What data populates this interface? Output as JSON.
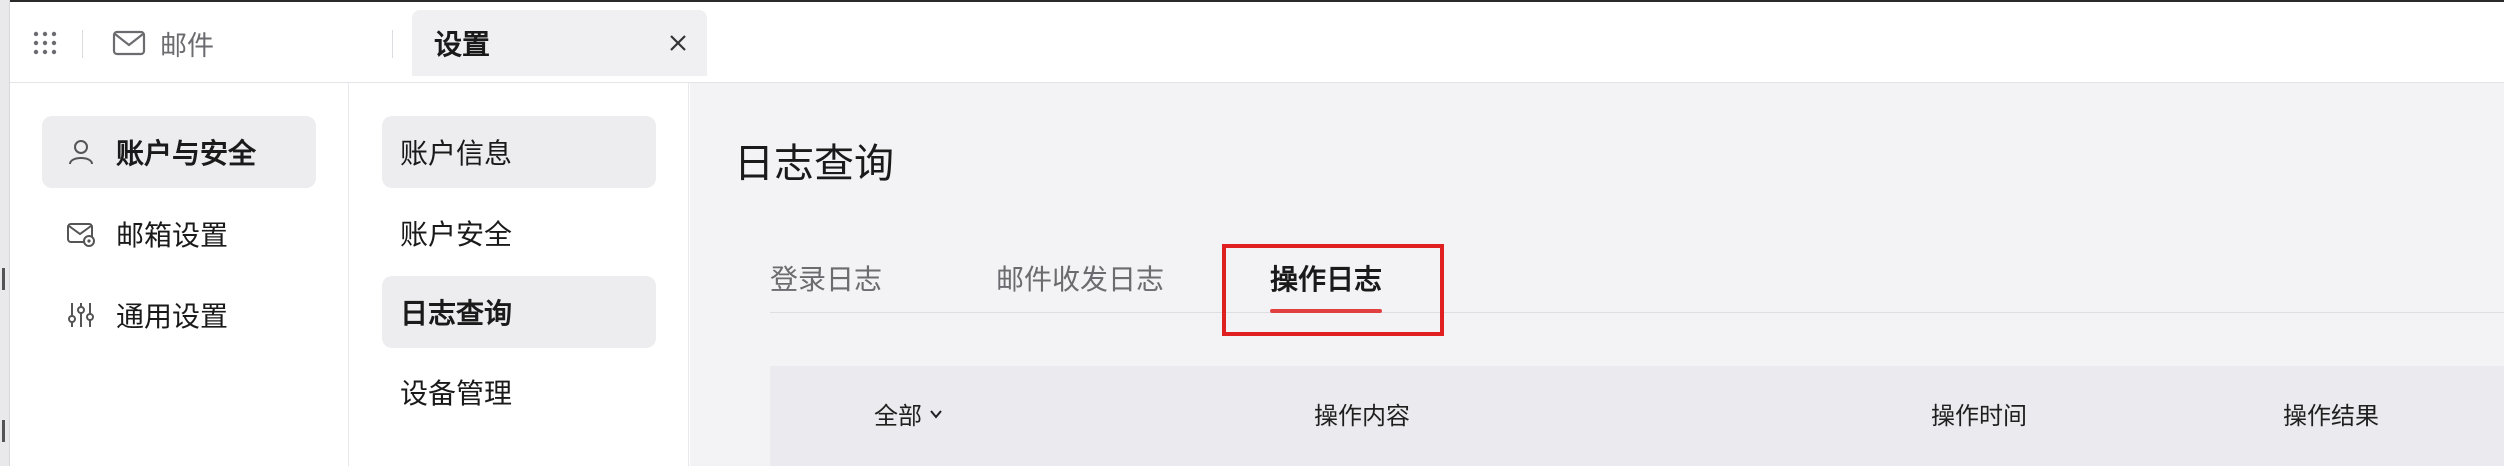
{
  "topbar": {
    "apps_icon": "grid-dots-icon",
    "mail_label": "邮件",
    "active_tab_label": "设置"
  },
  "sidebar_primary": {
    "items": [
      {
        "label": "账户与安全",
        "icon": "user-icon",
        "active": true
      },
      {
        "label": "邮箱设置",
        "icon": "mail-settings-icon",
        "active": false
      },
      {
        "label": "通用设置",
        "icon": "sliders-icon",
        "active": false
      }
    ]
  },
  "sidebar_secondary": {
    "items": [
      {
        "label": "账户信息",
        "active": true
      },
      {
        "label": "账户安全",
        "active": false
      },
      {
        "label": "日志查询",
        "active": true
      },
      {
        "label": "设备管理",
        "active": false
      }
    ]
  },
  "main": {
    "title": "日志查询",
    "tabs": [
      {
        "label": "登录日志",
        "active": false
      },
      {
        "label": "邮件收发日志",
        "active": false
      },
      {
        "label": "操作日志",
        "active": true
      }
    ],
    "table": {
      "columns": [
        "全部",
        "操作内容",
        "操作时间",
        "操作结果"
      ]
    }
  },
  "colors": {
    "accent": "#e04040",
    "highlight": "#e02020"
  }
}
